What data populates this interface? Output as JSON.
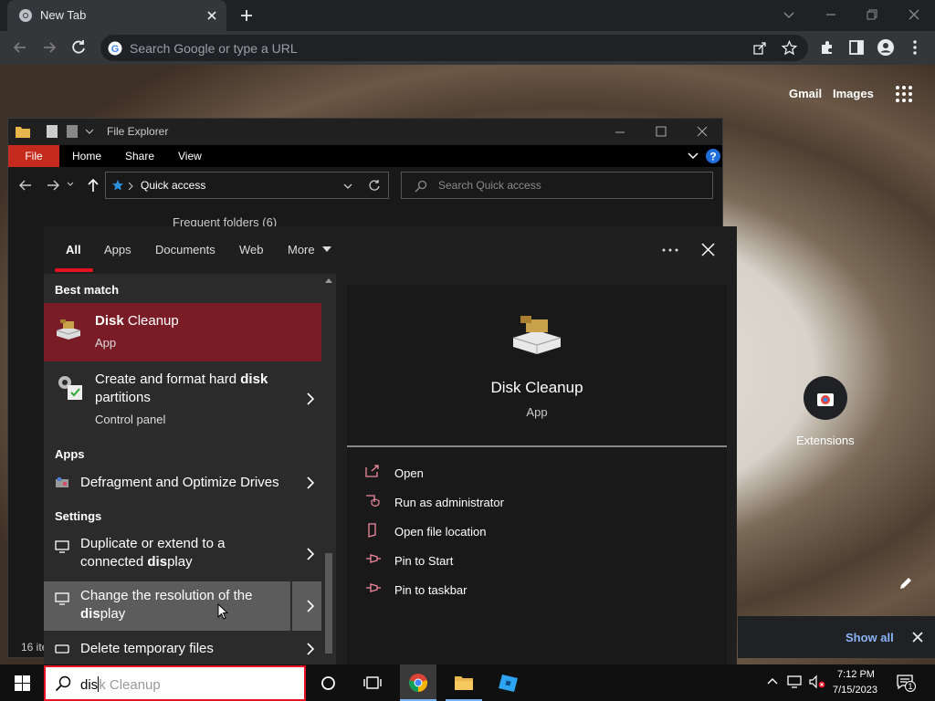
{
  "chrome": {
    "tab_title": "New Tab",
    "omnibox_placeholder": "Search Google or type a URL"
  },
  "ntp": {
    "gmail": "Gmail",
    "images": "Images",
    "shortcut_label": "Extensions",
    "show_all": "Show all"
  },
  "explorer": {
    "title": "File Explorer",
    "ribbon_tabs": [
      "File",
      "Home",
      "Share",
      "View"
    ],
    "address": "Quick access",
    "search_placeholder": "Search Quick access",
    "frequent_folders": "Frequent folders (6)",
    "item_count": "16 ite"
  },
  "search": {
    "filter_tabs": [
      "All",
      "Apps",
      "Documents",
      "Web",
      "More"
    ],
    "sections": {
      "best_match": "Best match",
      "apps": "Apps",
      "settings": "Settings"
    },
    "best_match": {
      "title_bold": "Disk",
      "title_rest": " Cleanup",
      "subtitle": "App"
    },
    "results": [
      {
        "title_pre": "Create and format hard ",
        "title_bold": "disk",
        "title_line2": "partitions",
        "subtitle": "Control panel"
      },
      {
        "title": "Defragment and Optimize Drives"
      },
      {
        "line1": "Duplicate or extend to a",
        "line2_pre": "connected ",
        "line2_bold": "dis",
        "line2_rest": "play"
      },
      {
        "line1": "Change the resolution of the",
        "line2_bold": "dis",
        "line2_rest": "play"
      },
      {
        "title": "Delete temporary files"
      }
    ],
    "detail": {
      "title": "Disk Cleanup",
      "subtitle": "App",
      "actions": [
        "Open",
        "Run as administrator",
        "Open file location",
        "Pin to Start",
        "Pin to taskbar"
      ]
    },
    "query_typed": "dis",
    "query_suggest": "k Cleanup"
  },
  "taskbar": {
    "time": "7:12 PM",
    "date": "7/15/2023",
    "notification_count": "1"
  }
}
